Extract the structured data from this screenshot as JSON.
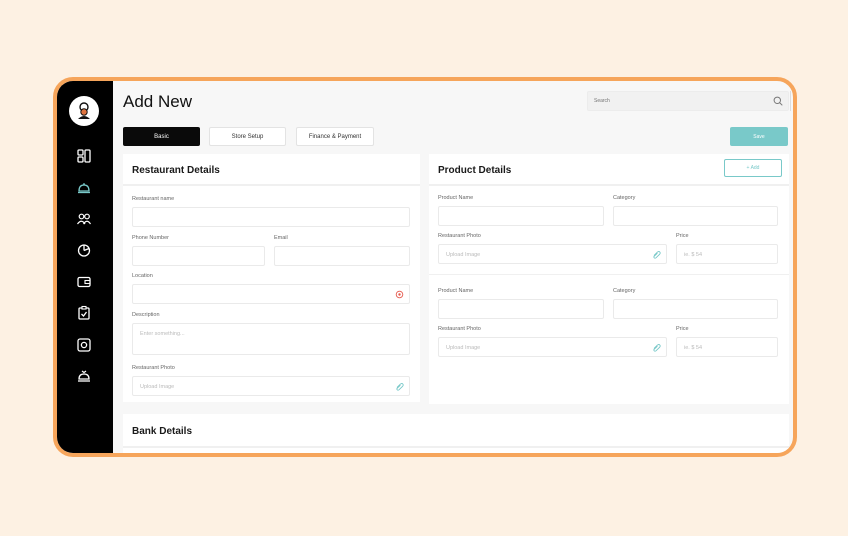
{
  "header": {
    "title": "Add New",
    "search_placeholder": "Search"
  },
  "tabs": [
    {
      "label": "Basic",
      "active": true
    },
    {
      "label": "Store Setup",
      "active": false
    },
    {
      "label": "Finance & Payment",
      "active": false
    }
  ],
  "save_label": "Save",
  "restaurant": {
    "title": "Restaurant Details",
    "name_label": "Restaurant name",
    "phone_label": "Phone Number",
    "email_label": "Email",
    "location_label": "Location",
    "description_label": "Description",
    "description_placeholder": "Enter something...",
    "photo_label": "Restaurant Photo",
    "photo_placeholder": "Upload Image"
  },
  "product": {
    "title": "Product Details",
    "add_label": "+ Add",
    "items": [
      {
        "name_label": "Product Name",
        "category_label": "Category",
        "photo_label": "Restaurant Photo",
        "photo_placeholder": "Upload Image",
        "price_label": "Price",
        "price_placeholder": "ie. $ 54"
      },
      {
        "name_label": "Product Name",
        "category_label": "Category",
        "photo_label": "Restaurant Photo",
        "photo_placeholder": "Upload Image",
        "price_label": "Price",
        "price_placeholder": "ie. $ 54"
      }
    ]
  },
  "bank": {
    "title": "Bank Details"
  },
  "icons": {
    "nav": [
      "grid-icon",
      "dish-icon",
      "users-icon",
      "pie-chart-icon",
      "wallet-icon",
      "clipboard-check-icon",
      "settings-icon",
      "delivery-icon"
    ],
    "search": "search-icon",
    "notification": "bell-icon",
    "location": "location-pin-icon",
    "attachment": "paperclip-icon"
  },
  "colors": {
    "accent": "#79c9c9",
    "frame": "#f6a55b",
    "background": "#fdf1e3",
    "sidebar": "#000000",
    "location_icon": "#e55a4e"
  }
}
